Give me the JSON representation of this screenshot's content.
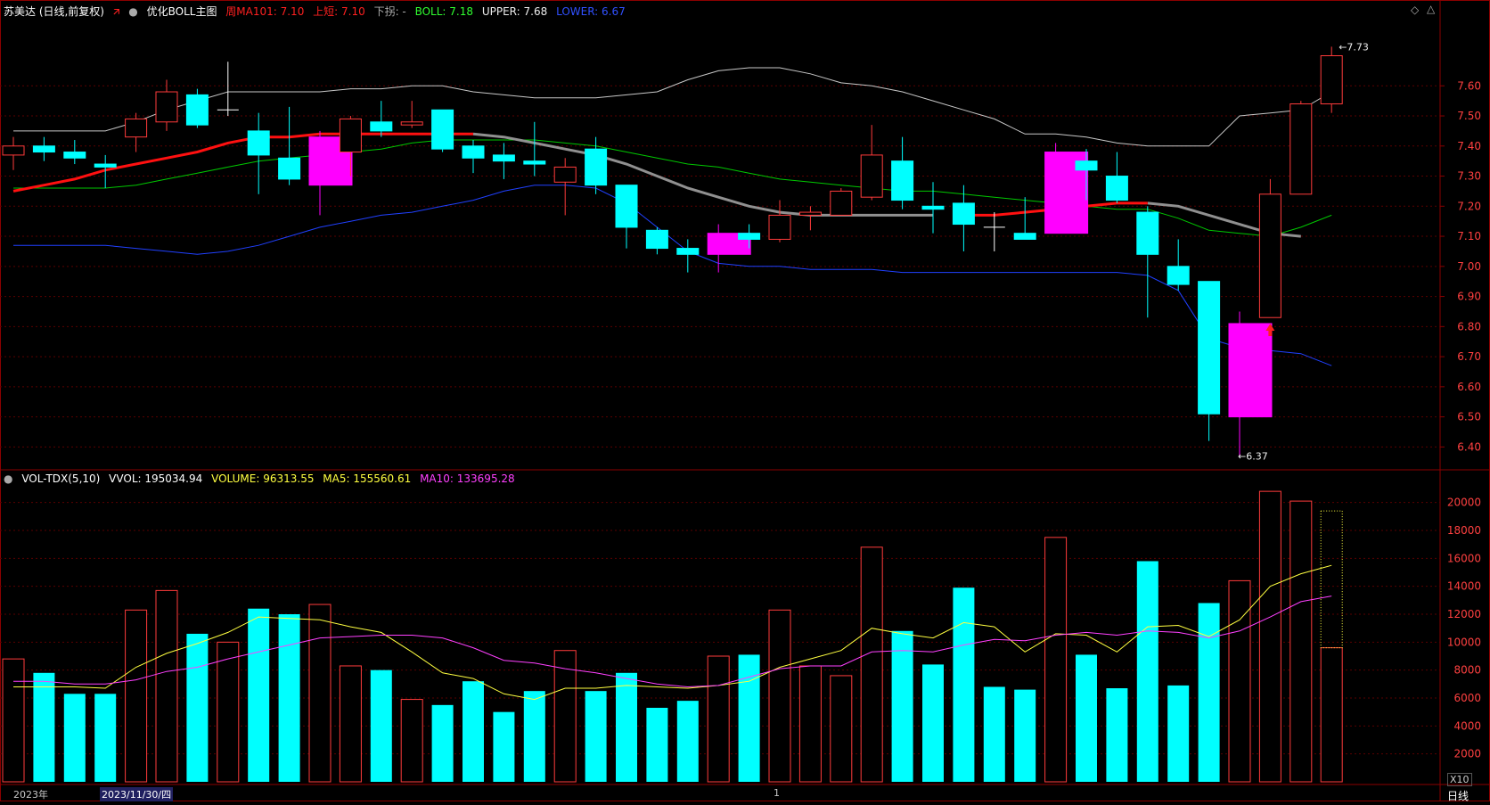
{
  "price_header": {
    "stock": "苏美达 (日线,前复权)",
    "indicator": "优化BOLL主图",
    "ma101": "周MA101: 7.10",
    "up_break": "上短: 7.10",
    "down_break": "下拐: -",
    "boll": "BOLL: 7.18",
    "upper": "UPPER: 7.68",
    "lower": "LOWER: 6.67"
  },
  "volume_header": {
    "name": "VOL-TDX(5,10)",
    "vvol": "VVOL: 195034.94",
    "volume": "VOLUME: 96313.55",
    "ma5": "MA5: 155560.61",
    "ma10": "MA10: 133695.28"
  },
  "labels": {
    "high_marker": "7.73",
    "low_marker": "6.37",
    "year": "2023年",
    "date": "2023/11/30/四",
    "month_tick": "1",
    "x10": "X10",
    "period": "日线"
  },
  "colors": {
    "up": "#ff3b3b",
    "down": "#00ffff",
    "magenta": "#ff00ff",
    "mid": "#00c800",
    "upper": "#c8c8c8",
    "lower": "#2040ff",
    "ma101": "#ff1010",
    "ma101_flat": "#909090",
    "ma5": "#ffff40",
    "ma10": "#ff40ff",
    "grid": "#5a0000"
  },
  "chart_data": [
    {
      "type": "candlestick",
      "title": "苏美达 (日线,前复权)",
      "ylim": [
        6.33,
        7.82
      ],
      "y_ticks": [
        6.4,
        6.5,
        6.6,
        6.7,
        6.8,
        6.9,
        7.0,
        7.1,
        7.2,
        7.3,
        7.4,
        7.5,
        7.6
      ],
      "candles": [
        {
          "o": 7.37,
          "c": 7.4,
          "h": 7.43,
          "l": 7.32,
          "color": "up"
        },
        {
          "o": 7.4,
          "c": 7.38,
          "h": 7.43,
          "l": 7.35,
          "color": "down"
        },
        {
          "o": 7.38,
          "c": 7.36,
          "h": 7.42,
          "l": 7.34,
          "color": "down"
        },
        {
          "o": 7.34,
          "c": 7.33,
          "h": 7.37,
          "l": 7.26,
          "color": "down"
        },
        {
          "o": 7.43,
          "c": 7.49,
          "h": 7.51,
          "l": 7.38,
          "color": "up"
        },
        {
          "o": 7.48,
          "c": 7.58,
          "h": 7.62,
          "l": 7.45,
          "color": "up"
        },
        {
          "o": 7.57,
          "c": 7.47,
          "h": 7.59,
          "l": 7.46,
          "color": "down"
        },
        {
          "o": 7.52,
          "c": 7.52,
          "h": 7.68,
          "l": 7.5,
          "color": "white"
        },
        {
          "o": 7.45,
          "c": 7.37,
          "h": 7.51,
          "l": 7.24,
          "color": "down"
        },
        {
          "o": 7.36,
          "c": 7.29,
          "h": 7.53,
          "l": 7.27,
          "color": "down"
        },
        {
          "o": 7.27,
          "c": 7.43,
          "h": 7.45,
          "l": 7.17,
          "color": "magenta"
        },
        {
          "o": 7.38,
          "c": 7.49,
          "h": 7.5,
          "l": 7.3,
          "color": "up"
        },
        {
          "o": 7.48,
          "c": 7.45,
          "h": 7.55,
          "l": 7.43,
          "color": "down"
        },
        {
          "o": 7.47,
          "c": 7.48,
          "h": 7.55,
          "l": 7.46,
          "color": "up"
        },
        {
          "o": 7.52,
          "c": 7.39,
          "h": 7.52,
          "l": 7.38,
          "color": "down"
        },
        {
          "o": 7.4,
          "c": 7.36,
          "h": 7.42,
          "l": 7.31,
          "color": "down"
        },
        {
          "o": 7.37,
          "c": 7.35,
          "h": 7.41,
          "l": 7.29,
          "color": "down"
        },
        {
          "o": 7.35,
          "c": 7.34,
          "h": 7.48,
          "l": 7.3,
          "color": "down"
        },
        {
          "o": 7.28,
          "c": 7.33,
          "h": 7.36,
          "l": 7.17,
          "color": "up"
        },
        {
          "o": 7.39,
          "c": 7.27,
          "h": 7.43,
          "l": 7.24,
          "color": "down"
        },
        {
          "o": 7.27,
          "c": 7.13,
          "h": 7.27,
          "l": 7.06,
          "color": "down"
        },
        {
          "o": 7.12,
          "c": 7.06,
          "h": 7.13,
          "l": 7.04,
          "color": "down"
        },
        {
          "o": 7.06,
          "c": 7.04,
          "h": 7.09,
          "l": 6.98,
          "color": "down"
        },
        {
          "o": 7.04,
          "c": 7.11,
          "h": 7.14,
          "l": 6.98,
          "color": "magenta"
        },
        {
          "o": 7.11,
          "c": 7.09,
          "h": 7.14,
          "l": 7.06,
          "color": "down"
        },
        {
          "o": 7.09,
          "c": 7.17,
          "h": 7.22,
          "l": 7.08,
          "color": "up"
        },
        {
          "o": 7.17,
          "c": 7.18,
          "h": 7.2,
          "l": 7.12,
          "color": "up"
        },
        {
          "o": 7.17,
          "c": 7.25,
          "h": 7.26,
          "l": 7.17,
          "color": "up"
        },
        {
          "o": 7.23,
          "c": 7.37,
          "h": 7.47,
          "l": 7.22,
          "color": "up"
        },
        {
          "o": 7.35,
          "c": 7.22,
          "h": 7.43,
          "l": 7.19,
          "color": "down"
        },
        {
          "o": 7.2,
          "c": 7.19,
          "h": 7.28,
          "l": 7.11,
          "color": "down"
        },
        {
          "o": 7.21,
          "c": 7.14,
          "h": 7.27,
          "l": 7.05,
          "color": "down"
        },
        {
          "o": 7.13,
          "c": 7.13,
          "h": 7.18,
          "l": 7.05,
          "color": "white"
        },
        {
          "o": 7.11,
          "c": 7.09,
          "h": 7.23,
          "l": 7.09,
          "color": "down"
        },
        {
          "o": 7.11,
          "c": 7.38,
          "h": 7.41,
          "l": 7.11,
          "color": "magenta"
        },
        {
          "o": 7.35,
          "c": 7.32,
          "h": 7.39,
          "l": 7.22,
          "color": "down"
        },
        {
          "o": 7.3,
          "c": 7.22,
          "h": 7.38,
          "l": 7.21,
          "color": "down"
        },
        {
          "o": 7.18,
          "c": 7.04,
          "h": 7.2,
          "l": 6.83,
          "color": "down"
        },
        {
          "o": 7.0,
          "c": 6.94,
          "h": 7.09,
          "l": 6.92,
          "color": "down"
        },
        {
          "o": 6.95,
          "c": 6.51,
          "h": 6.95,
          "l": 6.42,
          "color": "down"
        },
        {
          "o": 6.5,
          "c": 6.81,
          "h": 6.85,
          "l": 6.37,
          "color": "magenta"
        },
        {
          "o": 6.83,
          "c": 7.24,
          "h": 7.29,
          "l": 6.83,
          "color": "up"
        },
        {
          "o": 7.24,
          "c": 7.54,
          "h": 7.55,
          "l": 7.24,
          "color": "up"
        },
        {
          "o": 7.54,
          "c": 7.7,
          "h": 7.73,
          "l": 7.51,
          "color": "up"
        }
      ],
      "boll_upper": [
        7.45,
        7.45,
        7.45,
        7.45,
        7.48,
        7.52,
        7.55,
        7.58,
        7.58,
        7.58,
        7.58,
        7.59,
        7.59,
        7.6,
        7.6,
        7.58,
        7.57,
        7.56,
        7.56,
        7.56,
        7.57,
        7.58,
        7.62,
        7.65,
        7.66,
        7.66,
        7.64,
        7.61,
        7.6,
        7.58,
        7.55,
        7.52,
        7.49,
        7.44,
        7.44,
        7.43,
        7.41,
        7.4,
        7.4,
        7.4,
        7.5,
        7.51,
        7.52,
        7.58
      ],
      "boll_mid": [
        7.26,
        7.26,
        7.26,
        7.26,
        7.27,
        7.29,
        7.31,
        7.33,
        7.35,
        7.36,
        7.37,
        7.38,
        7.39,
        7.41,
        7.42,
        7.42,
        7.42,
        7.42,
        7.41,
        7.4,
        7.38,
        7.36,
        7.34,
        7.33,
        7.31,
        7.29,
        7.28,
        7.27,
        7.26,
        7.25,
        7.25,
        7.24,
        7.23,
        7.22,
        7.21,
        7.2,
        7.19,
        7.19,
        7.16,
        7.12,
        7.11,
        7.1,
        7.13,
        7.17
      ],
      "boll_lower": [
        7.07,
        7.07,
        7.07,
        7.07,
        7.06,
        7.05,
        7.04,
        7.05,
        7.07,
        7.1,
        7.13,
        7.15,
        7.17,
        7.18,
        7.2,
        7.22,
        7.25,
        7.27,
        7.27,
        7.26,
        7.21,
        7.13,
        7.05,
        7.01,
        7.0,
        7.0,
        6.99,
        6.99,
        6.99,
        6.98,
        6.98,
        6.98,
        6.98,
        6.98,
        6.98,
        6.98,
        6.98,
        6.97,
        6.92,
        6.76,
        6.73,
        6.72,
        6.71,
        6.67
      ],
      "ma101": [
        7.25,
        7.27,
        7.29,
        7.32,
        7.34,
        7.36,
        7.38,
        7.41,
        7.43,
        7.43,
        7.44,
        7.44,
        7.44,
        7.44,
        7.44,
        7.44,
        null,
        null,
        null,
        null,
        null,
        null,
        null,
        null,
        null,
        null,
        null,
        null,
        null,
        null,
        null,
        7.17,
        7.17,
        7.18,
        7.19,
        7.2,
        7.21,
        7.21,
        null,
        null,
        null,
        null,
        null,
        7.1
      ],
      "ma101_flat": [
        null,
        null,
        null,
        null,
        null,
        null,
        null,
        null,
        null,
        null,
        null,
        null,
        null,
        null,
        null,
        7.44,
        7.43,
        7.41,
        7.39,
        7.37,
        7.34,
        7.3,
        7.26,
        7.23,
        7.2,
        7.18,
        7.17,
        7.17,
        7.17,
        7.17,
        7.17,
        null,
        null,
        null,
        null,
        null,
        null,
        7.21,
        7.2,
        7.17,
        7.14,
        7.11,
        7.1,
        null
      ]
    },
    {
      "type": "bar",
      "title": "VOL-TDX(5,10)",
      "ylim": [
        0,
        21000
      ],
      "y_ticks": [
        2000,
        4000,
        6000,
        8000,
        10000,
        12000,
        14000,
        16000,
        18000,
        20000
      ],
      "values": [
        8800,
        7800,
        6300,
        6300,
        12300,
        13700,
        10600,
        10000,
        12400,
        12000,
        12700,
        8300,
        8000,
        5900,
        5500,
        7200,
        5000,
        6500,
        9400,
        6500,
        7800,
        5300,
        5800,
        9000,
        9100,
        12300,
        8300,
        7600,
        16800,
        10800,
        8400,
        13900,
        6800,
        6600,
        17500,
        9100,
        6700,
        15800,
        6900,
        12800,
        14400,
        20800,
        20100,
        9600
      ],
      "colors": [
        "up",
        "down",
        "down",
        "down",
        "up",
        "up",
        "down",
        "up",
        "down",
        "down",
        "up",
        "up",
        "down",
        "up",
        "down",
        "down",
        "down",
        "down",
        "up",
        "down",
        "down",
        "down",
        "down",
        "up",
        "down",
        "up",
        "up",
        "up",
        "up",
        "down",
        "down",
        "down",
        "down",
        "down",
        "up",
        "down",
        "down",
        "down",
        "down",
        "down",
        "up",
        "up",
        "up",
        "up"
      ],
      "forecast_volume": 19400,
      "ma5": [
        6800,
        6800,
        6800,
        6700,
        8200,
        9200,
        9900,
        10700,
        11800,
        11700,
        11600,
        11100,
        10700,
        9300,
        7800,
        7400,
        6300,
        5900,
        6700,
        6700,
        6900,
        6800,
        6700,
        6900,
        7200,
        8200,
        8800,
        9400,
        11000,
        10600,
        10300,
        11400,
        11100,
        9300,
        10600,
        10500,
        9300,
        11100,
        11200,
        10400,
        11600,
        14000,
        14900,
        15500
      ],
      "ma10": [
        7200,
        7200,
        7000,
        7000,
        7300,
        7900,
        8200,
        8800,
        9300,
        9800,
        10300,
        10400,
        10500,
        10500,
        10300,
        9600,
        8700,
        8500,
        8100,
        7800,
        7400,
        7000,
        6800,
        6900,
        7500,
        8100,
        8300,
        8300,
        9300,
        9400,
        9300,
        9800,
        10200,
        10100,
        10500,
        10700,
        10500,
        10800,
        10700,
        10300,
        10800,
        11800,
        12900,
        13300
      ]
    }
  ]
}
